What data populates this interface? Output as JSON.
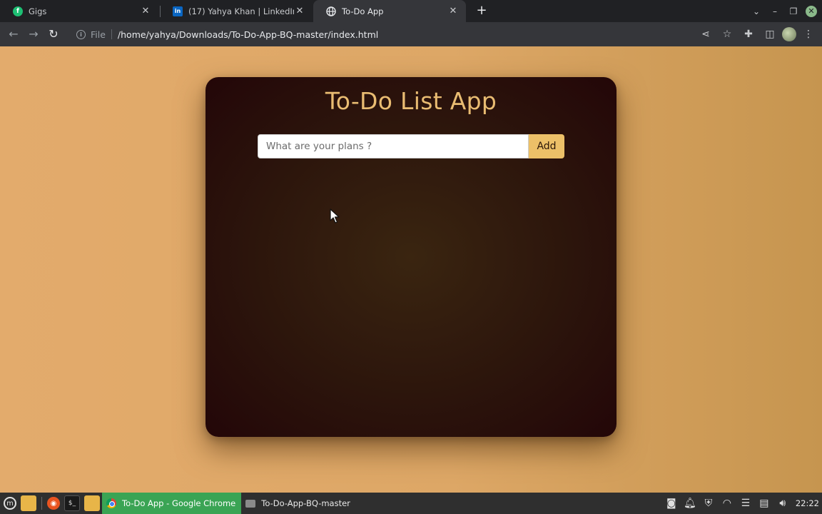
{
  "browser": {
    "tabs": [
      {
        "title": "Gigs",
        "favicon": "fiverr-icon",
        "active": false
      },
      {
        "title": "(17) Yahya Khan | LinkedIn",
        "favicon": "linkedin-icon",
        "active": false
      },
      {
        "title": "To-Do App",
        "favicon": "globe-icon",
        "active": true
      }
    ],
    "address": {
      "scheme_label": "File",
      "url": "/home/yahya/Downloads/To-Do-App-BQ-master/index.html"
    }
  },
  "app": {
    "title": "To-Do List App",
    "input": {
      "value": "",
      "placeholder": "What are your plans ?"
    },
    "add_label": "Add",
    "colors": {
      "title": "#e9bc72",
      "add_button": "#ecc068",
      "card": "#2c150c",
      "page": "#e3ab6c"
    }
  },
  "taskbar": {
    "windows": [
      {
        "title": "To-Do App - Google Chrome",
        "active": true
      },
      {
        "title": "To-Do-App-BQ-master",
        "active": false
      }
    ],
    "clock": "22:22"
  }
}
